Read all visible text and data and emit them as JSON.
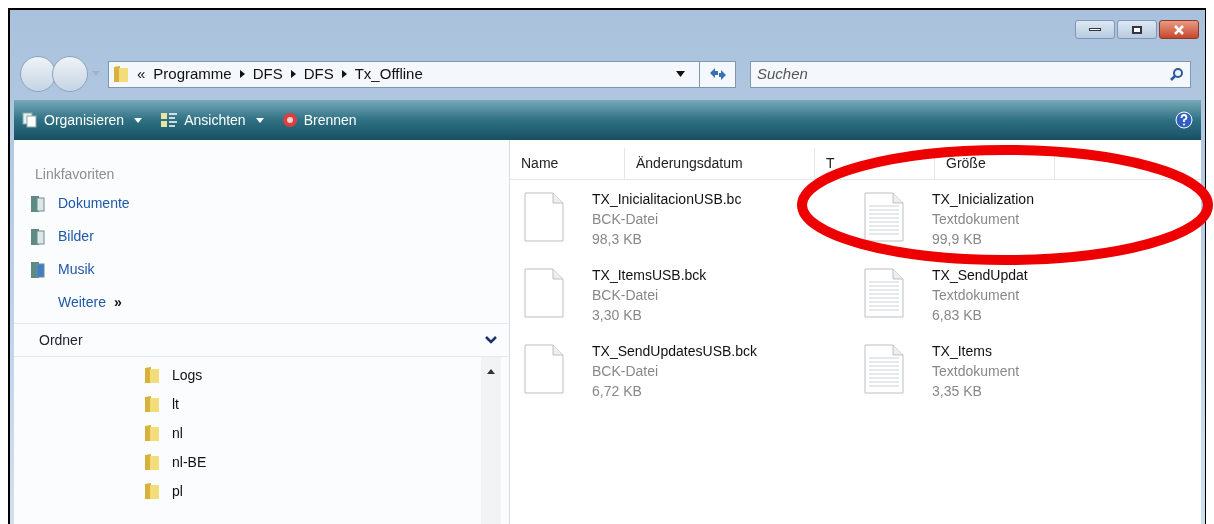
{
  "address_bar": {
    "overflow": "«",
    "path": [
      "Programme",
      "DFS",
      "DFS",
      "Tx_Offline"
    ]
  },
  "search": {
    "placeholder": "Suchen"
  },
  "toolbar": [
    {
      "label": "Organisieren",
      "kind": "organize",
      "dropdown": true
    },
    {
      "label": "Ansichten",
      "kind": "views",
      "dropdown": true
    },
    {
      "label": "Brennen",
      "kind": "burn",
      "dropdown": false
    }
  ],
  "nav_pane": {
    "favorites_title": "Linkfavoriten",
    "favorites": [
      {
        "label": "Dokumente",
        "kind": "documents"
      },
      {
        "label": "Bilder",
        "kind": "pictures"
      },
      {
        "label": "Musik",
        "kind": "music"
      },
      {
        "label": "Weitere",
        "kind": "more",
        "chevron": "»"
      }
    ],
    "folders_title": "Ordner",
    "folders": [
      "Logs",
      "lt",
      "nl",
      "nl-BE",
      "pl"
    ]
  },
  "columns": [
    "Name",
    "Änderungsdatum",
    "T",
    "Größe"
  ],
  "files": [
    {
      "name": "TX_InicialitacionUSB.bc",
      "type": "BCK-Datei",
      "size": "98,3 KB",
      "kind": "blank"
    },
    {
      "name": "TX_Inicialization",
      "type": "Textdokument",
      "size": "99,9 KB",
      "kind": "text"
    },
    {
      "name": "TX_ItemsUSB.bck",
      "type": "BCK-Datei",
      "size": "3,30 KB",
      "kind": "blank"
    },
    {
      "name": "TX_SendUpdat",
      "type": "Textdokument",
      "size": "6,83 KB",
      "kind": "text"
    },
    {
      "name": "TX_SendUpdatesUSB.bck",
      "type": "BCK-Datei",
      "size": "6,72 KB",
      "kind": "blank"
    },
    {
      "name": "TX_Items",
      "type": "Textdokument",
      "size": "3,35 KB",
      "kind": "text"
    }
  ]
}
